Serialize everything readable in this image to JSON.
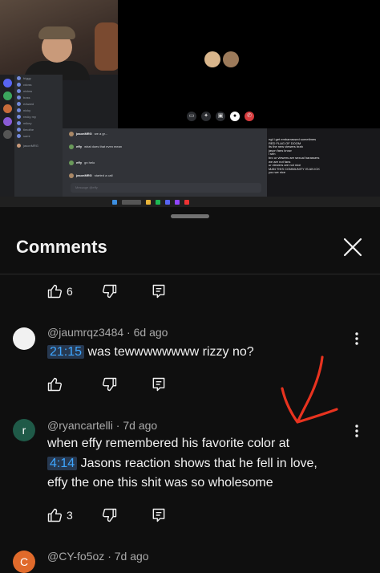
{
  "video": {
    "members": [
      "friggy",
      "cdoss",
      "nickss",
      "boss",
      "edward",
      "nicky",
      "recky my",
      "mikey",
      "timothe",
      "sami"
    ],
    "call_user": "jasonMRG",
    "chat_messages": [
      {
        "name": "jasonMRG",
        "text": "we a gr..."
      },
      {
        "name": "effy",
        "text": "what does that even mean"
      },
      {
        "name": "effy",
        "text": "gn helo"
      },
      {
        "name": "jasonMRG",
        "text": "started a call"
      }
    ],
    "chat_input_placeholder": "Message @effy",
    "twitch_lines": [
      "ngl I get embarrassed sometimes",
      "RED FLAG OF DOOM",
      "its the new viewers brah",
      "jason fans know",
      "i shh",
      "bro ur viewers are sexual harassers",
      "we are not fans",
      "ur viewers are not nice",
      "MAN THIS COMMUNITY IS AN ICK",
      "you we nice"
    ]
  },
  "sheet": {
    "title": "Comments",
    "colors": {
      "background": "#0f0f0f",
      "text": "#f1f1f1",
      "meta": "#aaaaaa",
      "timestamp": "#3ea6ff",
      "annotation": "#e8331f"
    }
  },
  "comments": [
    {
      "like_count": "6"
    },
    {
      "handle": "@jaumrqz3484",
      "age": "6d ago",
      "timestamp": "21:15",
      "text": "was tewwwwwwww rizzy no?",
      "like_count": ""
    },
    {
      "avatar_letter": "r",
      "avatar_color": "#1f5a48",
      "handle": "@ryancartelli",
      "age": "7d ago",
      "line1": "when effy remembered his favorite color at",
      "timestamp": "4:14",
      "line2_rest": "Jasons reaction shows that he fell in love,",
      "line3": "effy the one this shit was so wholesome",
      "like_count": "3"
    },
    {
      "avatar_letter": "C",
      "avatar_color": "#e06a2b",
      "handle": "@CY-fo5oz",
      "age": "7d ago"
    }
  ],
  "sep": "·"
}
